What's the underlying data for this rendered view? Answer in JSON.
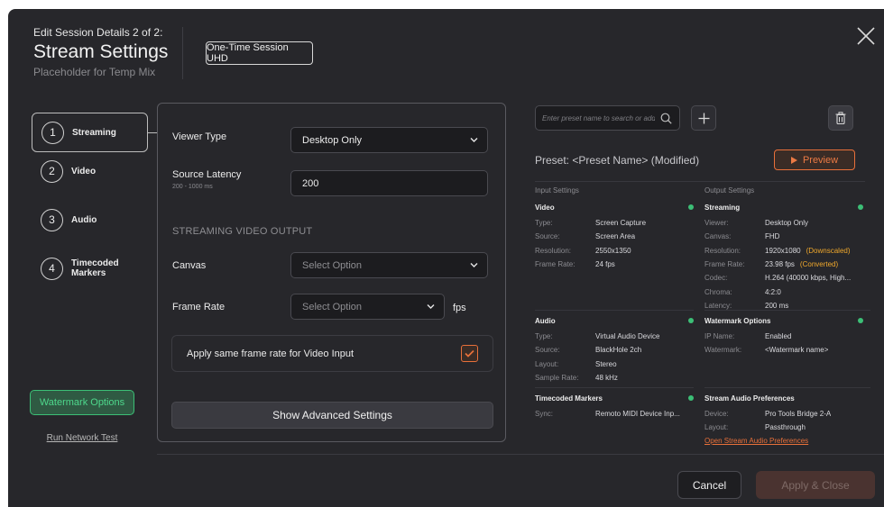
{
  "header": {
    "subtitle": "Edit Session Details 2 of 2:",
    "title": "Stream Settings",
    "placeholder": "Placeholder for Temp Mix",
    "session_button": "One-Time Session UHD",
    "close_icon": "close-icon"
  },
  "steps": [
    {
      "num": "1",
      "label": "Streaming",
      "active": true
    },
    {
      "num": "2",
      "label": "Video"
    },
    {
      "num": "3",
      "label": "Audio"
    },
    {
      "num": "4",
      "label": "Timecoded Markers"
    }
  ],
  "sidebar": {
    "watermark_button": "Watermark Options",
    "network_link": "Run Network Test"
  },
  "form": {
    "viewer_type_label": "Viewer Type",
    "viewer_type_value": "Desktop Only",
    "latency_label": "Source Latency",
    "latency_range": "200 - 1000 ms",
    "latency_value": "200",
    "section_title": "STREAMING VIDEO OUTPUT",
    "canvas_label": "Canvas",
    "canvas_placeholder": "Select Option",
    "frame_rate_label": "Frame Rate",
    "frame_rate_placeholder": "Select Option",
    "fps_unit": "fps",
    "same_rate_label": "Apply same frame rate for Video Input",
    "same_rate_checked": true,
    "advanced_button": "Show Advanced Settings"
  },
  "preset": {
    "search_placeholder": "Enter preset name to search or add",
    "name": "Preset: <Preset Name> (Modified)",
    "preview_button": "Preview",
    "input_heading": "Input Settings",
    "output_heading": "Output Settings"
  },
  "input_groups": {
    "video": {
      "title": "Video",
      "rows": [
        {
          "k": "Type:",
          "v": "Screen Capture"
        },
        {
          "k": "Source:",
          "v": "Screen Area"
        },
        {
          "k": "Resolution:",
          "v": "2550x1350"
        },
        {
          "k": "Frame Rate:",
          "v": "24 fps"
        }
      ]
    },
    "audio": {
      "title": "Audio",
      "rows": [
        {
          "k": "Type:",
          "v": "Virtual Audio Device"
        },
        {
          "k": "Source:",
          "v": "BlackHole 2ch"
        },
        {
          "k": "Layout:",
          "v": "Stereo"
        },
        {
          "k": "Sample Rate:",
          "v": "48 kHz"
        }
      ]
    },
    "markers": {
      "title": "Timecoded Markers",
      "rows": [
        {
          "k": "Sync:",
          "v": "Remoto MIDI Device Inp..."
        }
      ]
    }
  },
  "output_groups": {
    "streaming": {
      "title": "Streaming",
      "rows": [
        {
          "k": "Viewer:",
          "v": "Desktop Only"
        },
        {
          "k": "Canvas:",
          "v": "FHD"
        },
        {
          "k": "Resolution:",
          "v": "1920x1080",
          "note": "(Downscaled)"
        },
        {
          "k": "Frame Rate:",
          "v": "23.98 fps",
          "note": "(Converted)"
        },
        {
          "k": "Codec:",
          "v": "H.264 (40000 kbps, High..."
        },
        {
          "k": "Chroma:",
          "v": "4:2:0"
        },
        {
          "k": "Latency:",
          "v": "200 ms"
        }
      ]
    },
    "watermark": {
      "title": "Watermark Options",
      "rows": [
        {
          "k": "IP Name:",
          "v": "Enabled"
        },
        {
          "k": "Watermark:",
          "v": "<Watermark name>"
        }
      ]
    },
    "audio_prefs": {
      "title": "Stream Audio Preferences",
      "rows": [
        {
          "k": "Device:",
          "v": "Pro Tools Bridge 2-A"
        },
        {
          "k": "Layout:",
          "v": "Passthrough"
        }
      ],
      "link": "Open Stream Audio Preferences"
    }
  },
  "footer": {
    "cancel": "Cancel",
    "apply": "Apply & Close"
  },
  "colors": {
    "background": "#27272b",
    "accent_orange": "#e8703a",
    "accent_green": "#3cbf76",
    "warning": "#f0a82c"
  }
}
